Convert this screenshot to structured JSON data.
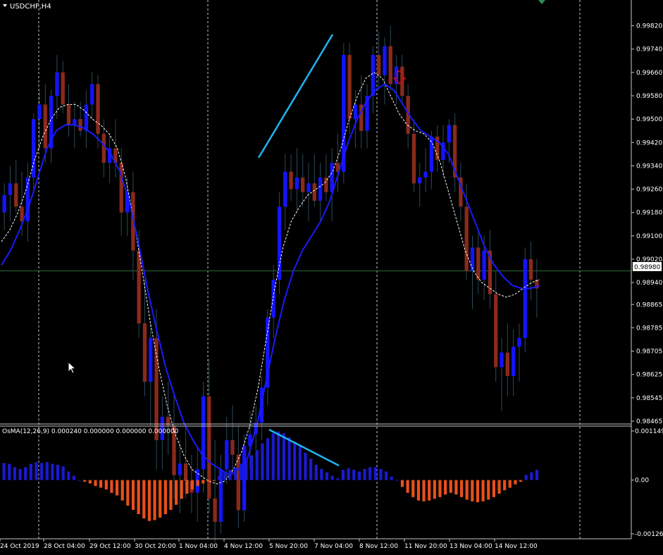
{
  "header": {
    "symbol_label": "USDCHF,H4"
  },
  "osma": {
    "label": "OsMA(12,26,9) 0.000240 0.000000 0.000000 0.000000"
  },
  "colors": {
    "background": "#000000",
    "grid": "#c8c8c8",
    "bull_candle": "#1414ff",
    "bear_candle": "#8b2a1a",
    "wick": "#2a4a5a",
    "fast_ma": "#ffffff",
    "slow_ma": "#1a1aff",
    "trendline": "#20b4f0",
    "osma_positive": "#1a1ad0",
    "osma_negative": "#e8501a",
    "arrow": "#d01010",
    "price_line": "#2e6e3a",
    "axis_text": "#ffffff"
  },
  "chart_data": [
    {
      "type": "candlestick",
      "symbol": "USDCHF",
      "timeframe": "H4",
      "ylim": [
        0.98465,
        0.9986
      ],
      "y_ticks": [
        "0.99820",
        "0.99740",
        "0.99660",
        "0.99580",
        "0.99500",
        "0.99420",
        "0.99340",
        "0.99260",
        "0.99180",
        "0.99100",
        "0.99020",
        "0.98940",
        "0.98865",
        "0.98785",
        "0.98705",
        "0.98625",
        "0.98545",
        "0.98465"
      ],
      "x_tick_labels": [
        "24 Oct 2019",
        "28 Oct 04:00",
        "29 Oct 12:00",
        "30 Oct 20:00",
        "1 Nov 04:00",
        "4 Nov 12:00",
        "5 Nov 20:00",
        "7 Nov 04:00",
        "8 Nov 12:00",
        "11 Nov 20:00",
        "13 Nov 04:00",
        "14 Nov 12:00"
      ],
      "current_price": "0.98980",
      "ohlc": [
        [
          0.9918,
          0.9928,
          0.9912,
          0.9924
        ],
        [
          0.9924,
          0.9934,
          0.9915,
          0.9928
        ],
        [
          0.9928,
          0.9936,
          0.9918,
          0.992
        ],
        [
          0.992,
          0.9932,
          0.991,
          0.9915
        ],
        [
          0.9915,
          0.9935,
          0.9908,
          0.993
        ],
        [
          0.993,
          0.9952,
          0.9926,
          0.995
        ],
        [
          0.995,
          0.996,
          0.994,
          0.9955
        ],
        [
          0.9955,
          0.9962,
          0.9935,
          0.994
        ],
        [
          0.994,
          0.996,
          0.9935,
          0.9958
        ],
        [
          0.9958,
          0.9972,
          0.995,
          0.9966
        ],
        [
          0.9966,
          0.997,
          0.9952,
          0.9955
        ],
        [
          0.9955,
          0.9962,
          0.9944,
          0.9948
        ],
        [
          0.9948,
          0.9956,
          0.994,
          0.995
        ],
        [
          0.995,
          0.9956,
          0.9944,
          0.9946
        ],
        [
          0.9946,
          0.996,
          0.994,
          0.9955
        ],
        [
          0.9955,
          0.9966,
          0.995,
          0.9962
        ],
        [
          0.9962,
          0.9965,
          0.994,
          0.9945
        ],
        [
          0.9945,
          0.995,
          0.993,
          0.9935
        ],
        [
          0.9935,
          0.9945,
          0.9928,
          0.994
        ],
        [
          0.994,
          0.995,
          0.993,
          0.9935
        ],
        [
          0.9935,
          0.994,
          0.991,
          0.9918
        ],
        [
          0.9918,
          0.993,
          0.991,
          0.9925
        ],
        [
          0.9925,
          0.9932,
          0.9895,
          0.9905
        ],
        [
          0.9905,
          0.9912,
          0.9875,
          0.988
        ],
        [
          0.988,
          0.9895,
          0.9855,
          0.986
        ],
        [
          0.986,
          0.988,
          0.9845,
          0.9875
        ],
        [
          0.9875,
          0.9885,
          0.983,
          0.984
        ],
        [
          0.984,
          0.9855,
          0.983,
          0.9848
        ],
        [
          0.9848,
          0.986,
          0.9835,
          0.9845
        ],
        [
          0.9845,
          0.9855,
          0.982,
          0.9828
        ],
        [
          0.9828,
          0.984,
          0.9815,
          0.9832
        ],
        [
          0.9832,
          0.9845,
          0.982,
          0.9826
        ],
        [
          0.9826,
          0.9835,
          0.9815,
          0.9822
        ],
        [
          0.9822,
          0.9838,
          0.9812,
          0.983
        ],
        [
          0.983,
          0.986,
          0.9822,
          0.9855
        ],
        [
          0.9855,
          0.9868,
          0.9815,
          0.982
        ],
        [
          0.982,
          0.984,
          0.9805,
          0.9812
        ],
        [
          0.9812,
          0.9835,
          0.9808,
          0.983
        ],
        [
          0.983,
          0.9848,
          0.9825,
          0.984
        ],
        [
          0.984,
          0.9852,
          0.9828,
          0.9835
        ],
        [
          0.9835,
          0.9845,
          0.981,
          0.9816
        ],
        [
          0.9816,
          0.9842,
          0.9812,
          0.9838
        ],
        [
          0.9838,
          0.985,
          0.983,
          0.9842
        ],
        [
          0.9842,
          0.9852,
          0.9834,
          0.9846
        ],
        [
          0.9846,
          0.9862,
          0.984,
          0.9858
        ],
        [
          0.9858,
          0.9885,
          0.9852,
          0.9882
        ],
        [
          0.9882,
          0.99,
          0.9875,
          0.9895
        ],
        [
          0.9895,
          0.9925,
          0.989,
          0.992
        ],
        [
          0.992,
          0.9938,
          0.9912,
          0.9932
        ],
        [
          0.9932,
          0.9938,
          0.9922,
          0.9926
        ],
        [
          0.9926,
          0.994,
          0.9918,
          0.993
        ],
        [
          0.993,
          0.9938,
          0.992,
          0.9925
        ],
        [
          0.9925,
          0.9935,
          0.9915,
          0.9928
        ],
        [
          0.9928,
          0.9938,
          0.992,
          0.9922
        ],
        [
          0.9922,
          0.9935,
          0.9915,
          0.993
        ],
        [
          0.993,
          0.9938,
          0.9922,
          0.9925
        ],
        [
          0.9925,
          0.994,
          0.9915,
          0.9935
        ],
        [
          0.9935,
          0.9945,
          0.9925,
          0.9932
        ],
        [
          0.9932,
          0.9976,
          0.9928,
          0.9972
        ],
        [
          0.9972,
          0.9976,
          0.9945,
          0.995
        ],
        [
          0.995,
          0.996,
          0.994,
          0.9955
        ],
        [
          0.9955,
          0.9965,
          0.994,
          0.9946
        ],
        [
          0.9946,
          0.9962,
          0.994,
          0.9958
        ],
        [
          0.9958,
          0.9975,
          0.9952,
          0.9972
        ],
        [
          0.9972,
          0.998,
          0.996,
          0.9965
        ],
        [
          0.9965,
          0.9978,
          0.9955,
          0.9975
        ],
        [
          0.9975,
          0.9982,
          0.996,
          0.9962
        ],
        [
          0.9962,
          0.9972,
          0.9955,
          0.9968
        ],
        [
          0.9968,
          0.9972,
          0.9955,
          0.9958
        ],
        [
          0.9958,
          0.9962,
          0.994,
          0.9945
        ],
        [
          0.9945,
          0.995,
          0.9925,
          0.9928
        ],
        [
          0.9928,
          0.9935,
          0.992,
          0.993
        ],
        [
          0.993,
          0.994,
          0.9925,
          0.9932
        ],
        [
          0.9932,
          0.9946,
          0.9926,
          0.9944
        ],
        [
          0.9944,
          0.9948,
          0.9932,
          0.9936
        ],
        [
          0.9936,
          0.9948,
          0.993,
          0.9942
        ],
        [
          0.9942,
          0.995,
          0.9935,
          0.9948
        ],
        [
          0.9948,
          0.9952,
          0.9925,
          0.993
        ],
        [
          0.993,
          0.9935,
          0.9915,
          0.992
        ],
        [
          0.992,
          0.9928,
          0.9895,
          0.9898
        ],
        [
          0.9898,
          0.991,
          0.9885,
          0.9906
        ],
        [
          0.9906,
          0.9912,
          0.989,
          0.9895
        ],
        [
          0.9895,
          0.991,
          0.9888,
          0.9905
        ],
        [
          0.9905,
          0.9912,
          0.9885,
          0.989
        ],
        [
          0.989,
          0.9898,
          0.986,
          0.9865
        ],
        [
          0.9865,
          0.9875,
          0.985,
          0.987
        ],
        [
          0.987,
          0.988,
          0.9855,
          0.9862
        ],
        [
          0.9862,
          0.9878,
          0.9855,
          0.9872
        ],
        [
          0.9872,
          0.988,
          0.986,
          0.9875
        ],
        [
          0.9875,
          0.9906,
          0.987,
          0.9902
        ],
        [
          0.9902,
          0.9908,
          0.9888,
          0.9895
        ],
        [
          0.9895,
          0.9902,
          0.9882,
          0.9892
        ]
      ],
      "series": [
        {
          "name": "",
          "values": [
            0.9908,
            0.9912,
            0.9918,
            0.9926,
            0.9936,
            0.9944,
            0.995,
            0.9954,
            0.9955,
            0.9955,
            0.9953,
            0.995,
            0.9948,
            0.9945,
            0.994,
            0.993,
            0.9915,
            0.9898,
            0.988,
            0.9865,
            0.9852,
            0.9842,
            0.9835,
            0.983,
            0.9828,
            0.9826,
            0.9825,
            0.9826,
            0.983,
            0.9836,
            0.9845,
            0.9858,
            0.9875,
            0.9892,
            0.9906,
            0.9915,
            0.992,
            0.9924,
            0.9926,
            0.9928,
            0.9932,
            0.994,
            0.995,
            0.9958,
            0.9964,
            0.9966,
            0.9964,
            0.9958,
            0.9952,
            0.9948,
            0.9946,
            0.9945,
            0.9942,
            0.9935,
            0.9925,
            0.9915,
            0.9905,
            0.9898,
            0.9894,
            0.9892,
            0.989,
            0.9889,
            0.989,
            0.9892,
            0.9894,
            0.9895
          ]
        },
        {
          "name": "",
          "values": [
            0.99,
            0.9905,
            0.9912,
            0.992,
            0.993,
            0.994,
            0.9946,
            0.9948,
            0.9948,
            0.9947,
            0.9945,
            0.9942,
            0.9938,
            0.9932,
            0.9922,
            0.9908,
            0.9892,
            0.9878,
            0.9865,
            0.9855,
            0.9846,
            0.984,
            0.9835,
            0.9832,
            0.983,
            0.9828,
            0.983,
            0.9834,
            0.9845,
            0.986,
            0.9875,
            0.9888,
            0.9898,
            0.9905,
            0.991,
            0.9915,
            0.9922,
            0.9932,
            0.9942,
            0.995,
            0.9956,
            0.996,
            0.9962,
            0.996,
            0.9955,
            0.995,
            0.9946,
            0.9944,
            0.9942,
            0.9938,
            0.993,
            0.9922,
            0.9914,
            0.9906,
            0.99,
            0.9896,
            0.9893,
            0.9892,
            0.9892,
            0.9893
          ]
        }
      ]
    },
    {
      "type": "bar",
      "title": "OsMA(12,26,9)",
      "values_printed": [
        "0.000240",
        "0.000000",
        "0.000000",
        "0.000000"
      ],
      "ylim": [
        -0.001262,
        0.001149
      ],
      "y_tick_labels": [
        "0.001149",
        "0.00",
        "-0.001262"
      ],
      "values": [
        0.0004,
        0.00038,
        0.0003,
        0.00026,
        0.0003,
        0.00038,
        0.00042,
        0.0004,
        0.00042,
        0.00038,
        0.00036,
        0.00032,
        0.0002,
        0.0001,
        0.0,
        -4e-05,
        -8e-05,
        -0.00014,
        -0.00018,
        -0.00022,
        -0.0003,
        -0.00036,
        -0.00048,
        -0.0006,
        -0.0007,
        -0.0008,
        -0.0009,
        -0.00096,
        -0.00094,
        -0.00088,
        -0.0008,
        -0.0007,
        -0.00058,
        -0.00044,
        -0.00032,
        -0.00022,
        -0.00014,
        -8e-05,
        -4e-05,
        -2e-05,
        0.0001,
        0.0002,
        0.00024,
        0.0003,
        0.00038,
        0.00048,
        0.00058,
        0.0007,
        0.00086,
        0.00098,
        0.0011,
        0.00114,
        0.0011,
        0.001,
        0.0009,
        0.0008,
        0.00064,
        0.0005,
        0.00036,
        0.00026,
        0.00018,
        0.0001,
        4e-05,
        0.00024,
        0.00028,
        0.00024,
        0.0002,
        0.00026,
        0.0003,
        0.0003,
        0.00026,
        0.0002,
        8e-05,
        0.0,
        -0.00016,
        -0.0003,
        -0.0004,
        -0.00048,
        -0.0005,
        -0.00048,
        -0.00044,
        -0.0004,
        -0.00034,
        -0.0003,
        -0.00034,
        -0.0004,
        -0.00046,
        -0.0005,
        -0.00052,
        -0.0005,
        -0.00046,
        -0.0004,
        -0.00032,
        -0.00024,
        -0.00018,
        -0.0001,
        -4e-05,
        0.00012,
        0.00018,
        0.00024
      ]
    }
  ]
}
